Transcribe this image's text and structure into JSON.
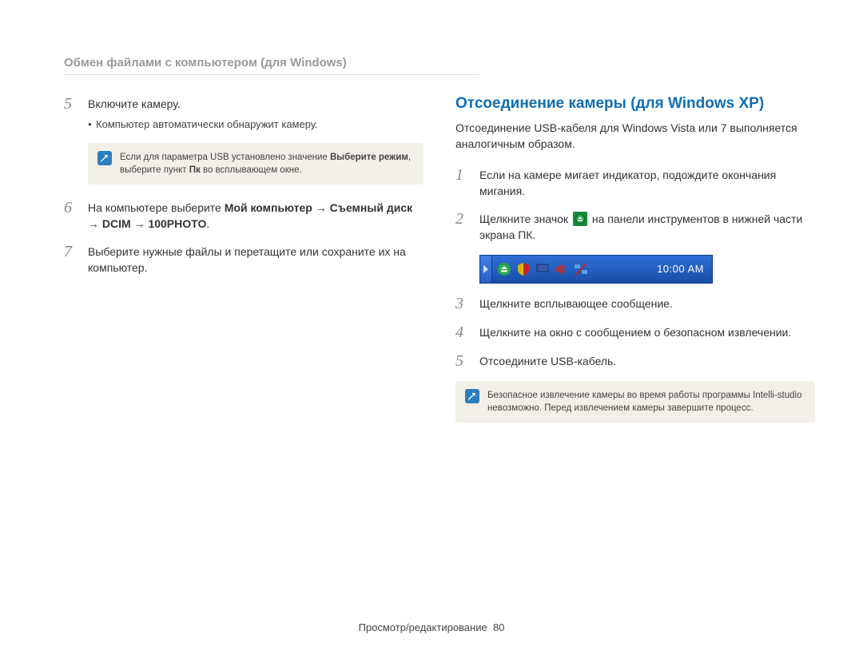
{
  "header": "Обмен файлами с компьютером (для Windows)",
  "left": {
    "step5": {
      "num": "5",
      "text": "Включите камеру.",
      "bullet1": "Компьютер автоматически обнаружит камеру."
    },
    "note1": {
      "pre": "Если для параметра USB установлено значение ",
      "bold1": "Выберите режим",
      "mid": ", выберите пункт ",
      "bold2": "Пк",
      "post": " во всплывающем окне."
    },
    "step6": {
      "num": "6",
      "pre": "На компьютере выберите ",
      "bold1": "Мой компьютер",
      "arrow1": " → ",
      "bold2": "Съемный диск",
      "arrow2": " → ",
      "bold3": "DCIM",
      "arrow3": " → ",
      "bold4": "100PHOTO",
      "suffix": "."
    },
    "step7": {
      "num": "7",
      "text": "Выберите нужные файлы и перетащите или сохраните их на компьютер."
    }
  },
  "right": {
    "title": "Отсоединение камеры (для Windows XP)",
    "intro": "Отсоединение USB-кабеля для Windows Vista или 7 выполняется аналогичным образом.",
    "step1": {
      "num": "1",
      "text": "Если на камере мигает индикатор, подождите окончания мигания."
    },
    "step2": {
      "num": "2",
      "pre": "Щелкните значок ",
      "post": " на панели инструментов в нижней части экрана ПК."
    },
    "clock": "10:00 AM",
    "step3": {
      "num": "3",
      "text": "Щелкните всплывающее сообщение."
    },
    "step4": {
      "num": "4",
      "text": "Щелкните на окно с сообщением о безопасном извлечении."
    },
    "step5b": {
      "num": "5",
      "text": "Отсоедините USB-кабель."
    },
    "note2": "Безопасное извлечение камеры во время работы программы Intelli-studio невозможно. Перед извлечением камеры завершите процесс."
  },
  "footer": {
    "label": "Просмотр/редактирование",
    "page": "80"
  }
}
